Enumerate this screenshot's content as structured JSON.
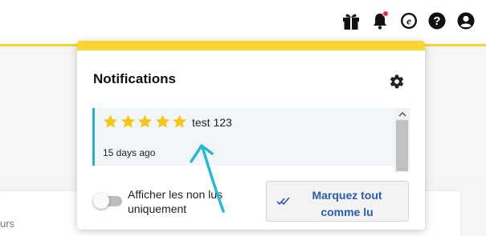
{
  "background": {
    "partial_text": "urs"
  },
  "header": {
    "icons": [
      "gift-icon",
      "bell-icon",
      "e-circle-icon",
      "help-icon",
      "account-icon"
    ],
    "has_notification_dot": true
  },
  "popup": {
    "title": "Notifications",
    "notifications": [
      {
        "rating": 5,
        "text": "test 123",
        "time": "15 days ago"
      }
    ],
    "toggle_label": "Afficher les non lus uniquement",
    "toggle_on": false,
    "mark_all_read_label": "Marquez tout comme lu"
  },
  "colors": {
    "accent_yellow": "#f8d531",
    "item_border": "#22b5c9",
    "star": "#f5c518",
    "button_text": "#2a5cab",
    "notification_dot": "#e0303a",
    "annotation_arrow": "#29b6d9"
  }
}
